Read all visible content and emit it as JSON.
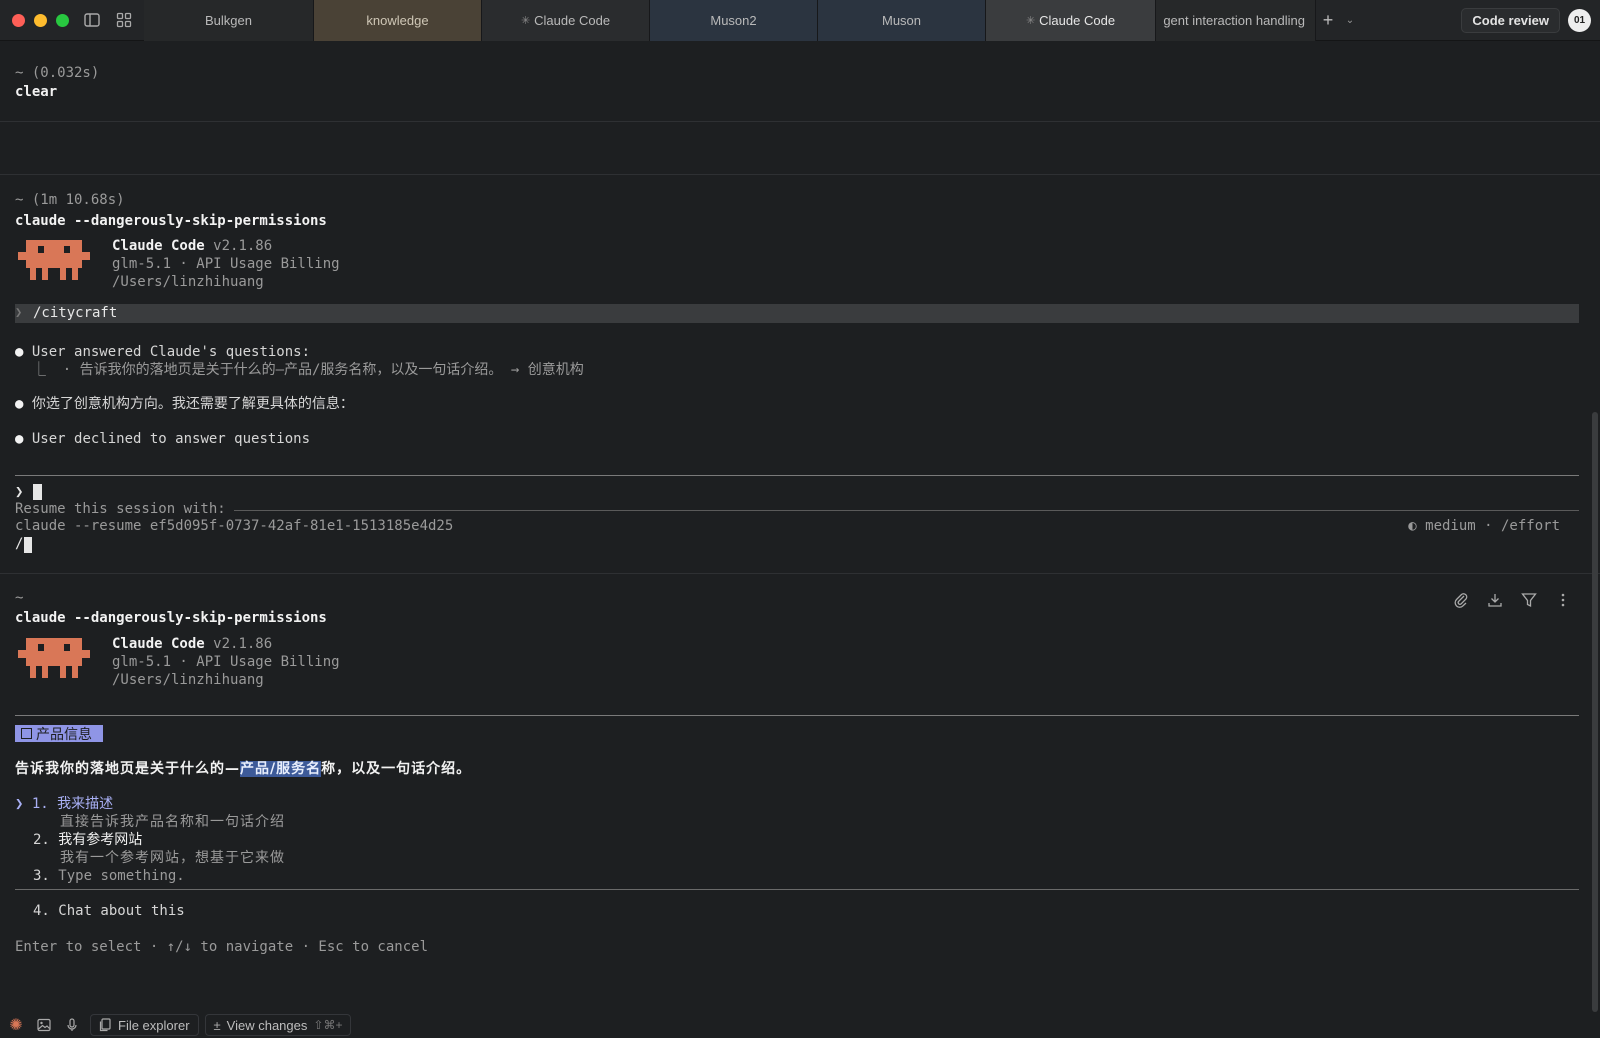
{
  "tabs": [
    {
      "label": "Bulkgen",
      "spinner": false
    },
    {
      "label": "knowledge",
      "spinner": false
    },
    {
      "label": "Claude Code",
      "spinner": true
    },
    {
      "label": "Muson2",
      "spinner": false
    },
    {
      "label": "Muson",
      "spinner": false
    },
    {
      "label": "Claude Code",
      "spinner": true,
      "active": true
    },
    {
      "label": "gent interaction handling",
      "spinner": false
    }
  ],
  "header": {
    "code_review_label": "Code review",
    "avatar_text": "01"
  },
  "block1": {
    "timing": "~ (0.032s)",
    "command": "clear"
  },
  "block2": {
    "timing": "~ (1m 10.68s)",
    "command": "claude --dangerously-skip-permissions",
    "app_name": "Claude Code",
    "version": "v2.1.86",
    "model_line": "glm-5.1 · API Usage Billing",
    "path": "/Users/linzhihuang",
    "prompt_text": "/citycraft",
    "msg1": "User answered Claude's questions:",
    "msg1_detail": "  ⎿  · 告诉我你的落地页是关于什么的—产品/服务名称，以及一句话介绍。 → 创意机构",
    "msg2": "你选了创意机构方向。我还需要了解更具体的信息：",
    "msg3": "User declined to answer questions",
    "input_chevron": "❯",
    "resume_label": "Resume this session with:",
    "resume_command": "claude --resume ef5d095f-0737-42af-81e1-1513185e4d25",
    "slash": "/",
    "effort": "◐ medium · /effort"
  },
  "block3": {
    "timing": "~",
    "command": "claude --dangerously-skip-permissions",
    "app_name": "Claude Code",
    "version": "v2.1.86",
    "model_line": "glm-5.1 · API Usage Billing",
    "path": "/Users/linzhihuang",
    "badge": "产品信息",
    "question_pre": "告诉我你的落地页是关于什么的—",
    "question_hl": "产品/服务名",
    "question_post": "称，以及一句话介绍。",
    "options": [
      {
        "num": "1.",
        "label": "我来描述",
        "desc": "直接告诉我产品名称和一句话介绍",
        "selected": true
      },
      {
        "num": "2.",
        "label": "我有参考网站",
        "desc": "我有一个参考网站，想基于它来做",
        "selected": false
      },
      {
        "num": "3.",
        "label": "Type something.",
        "desc": "",
        "selected": false
      }
    ],
    "chat_option": "4. Chat about this",
    "hint": "Enter to select · ↑/↓ to navigate · Esc to cancel"
  },
  "bottom": {
    "file_explorer": "File explorer",
    "view_changes": "View changes",
    "view_changes_kbd": "⇧⌘+"
  },
  "colors": {
    "background": "#1d1f21",
    "mascot": "#d97757",
    "badge": "#8f95e6",
    "highlight": "#3d5a99"
  }
}
